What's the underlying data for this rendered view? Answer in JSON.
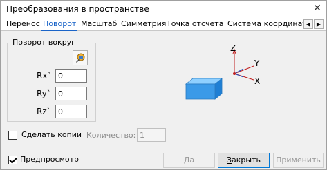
{
  "window": {
    "title": "Преобразования в пространстве",
    "close_glyph": "✕"
  },
  "tabs": [
    {
      "label": "Перенос",
      "active": false
    },
    {
      "label": "Поворот",
      "active": true
    },
    {
      "label": "Масштаб",
      "active": false
    },
    {
      "label": "Симметрия",
      "active": false
    },
    {
      "label": "Точка отсчета",
      "active": false
    },
    {
      "label": "Система координат",
      "active": false
    }
  ],
  "tab_scroll": {
    "left": "◀",
    "right": "▶"
  },
  "rotation_group": {
    "label": "Поворот вокруг",
    "pick_icon": "pick-point-icon",
    "fields": [
      {
        "label": "Rx`",
        "value": "0"
      },
      {
        "label": "Ry`",
        "value": "0"
      },
      {
        "label": "Rz`",
        "value": "0"
      }
    ]
  },
  "preview_axes": {
    "x": "X",
    "y": "Y",
    "z": "Z",
    "object_color": "#3b9ae8"
  },
  "make_copies": {
    "label": "Сделать копии",
    "checked": false
  },
  "quantity": {
    "label": "Количество:",
    "value": "1"
  },
  "preview": {
    "label": "Предпросмотр",
    "checked": true
  },
  "buttons": {
    "ok": "Да",
    "close_first": "З",
    "close_rest": "акрыть",
    "apply": "Применить"
  }
}
